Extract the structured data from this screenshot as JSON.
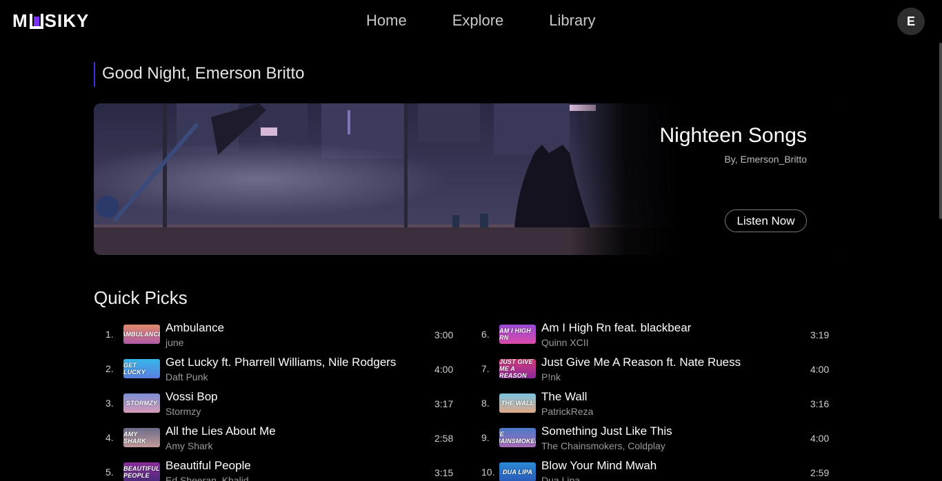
{
  "app": {
    "logo_text_left": "M",
    "logo_text_right": "SIKY"
  },
  "nav": {
    "items": [
      {
        "label": "Home"
      },
      {
        "label": "Explore"
      },
      {
        "label": "Library"
      }
    ]
  },
  "user": {
    "avatar_letter": "E"
  },
  "greeting": "Good Night, Emerson Britto",
  "hero": {
    "title": "Nighteen Songs",
    "subtitle": "By, Emerson_Britto",
    "button_label": "Listen Now"
  },
  "quick_picks": {
    "title": "Quick Picks",
    "tracks": [
      {
        "num": "1.",
        "title": "Ambulance",
        "artist": "june",
        "duration": "3:00",
        "cover_text": "AMBULANCE",
        "cover_from": "#e08a6b",
        "cover_to": "#b05aa8"
      },
      {
        "num": "2.",
        "title": "Get Lucky ft. Pharrell Williams, Nile Rodgers",
        "artist": "Daft Punk",
        "duration": "4:00",
        "cover_text": "GET LUCKY",
        "cover_from": "#35b8e8",
        "cover_to": "#5a7ee0"
      },
      {
        "num": "3.",
        "title": "Vossi Bop",
        "artist": "Stormzy",
        "duration": "3:17",
        "cover_text": "STORMZY",
        "cover_from": "#7d8fd6",
        "cover_to": "#d69ab8"
      },
      {
        "num": "4.",
        "title": "All the Lies About Me",
        "artist": "Amy Shark",
        "duration": "2:58",
        "cover_text": "AMY SHARK",
        "cover_from": "#6c6c8a",
        "cover_to": "#c49a9a"
      },
      {
        "num": "5.",
        "title": "Beautiful People",
        "artist": "Ed Sheeran, Khalid",
        "duration": "3:15",
        "cover_text": "BEAUTIFUL PEOPLE",
        "cover_from": "#8a2d9a",
        "cover_to": "#4a2a7a"
      },
      {
        "num": "6.",
        "title": "Am I High Rn feat. blackbear",
        "artist": "Quinn XCII",
        "duration": "3:19",
        "cover_text": "AM I HIGH RN",
        "cover_from": "#9a4ad6",
        "cover_to": "#d94aa8"
      },
      {
        "num": "7.",
        "title": "Just Give Me A Reason ft. Nate Ruess",
        "artist": "P!nk",
        "duration": "4:00",
        "cover_text": "JUST GIVE ME A REASON",
        "cover_from": "#d63a7a",
        "cover_to": "#8a2a9a"
      },
      {
        "num": "8.",
        "title": "The Wall",
        "artist": "PatrickReza",
        "duration": "3:16",
        "cover_text": "THE WALL",
        "cover_from": "#7ac4e0",
        "cover_to": "#e0a888"
      },
      {
        "num": "9.",
        "title": "Something Just Like This",
        "artist": "The Chainsmokers, Coldplay",
        "duration": "4:00",
        "cover_text": "THE CHAINSMOKERS",
        "cover_from": "#4a7ac8",
        "cover_to": "#a86ab8"
      },
      {
        "num": "10.",
        "title": "Blow Your Mind Mwah",
        "artist": "Dua Lipa",
        "duration": "2:59",
        "cover_text": "DUA LIPA",
        "cover_from": "#2a8ad6",
        "cover_to": "#2a5ab8"
      }
    ]
  },
  "colors": {
    "accent": "#3b35d6",
    "logo_accent": "#7b2ff7",
    "background": "#000000"
  }
}
